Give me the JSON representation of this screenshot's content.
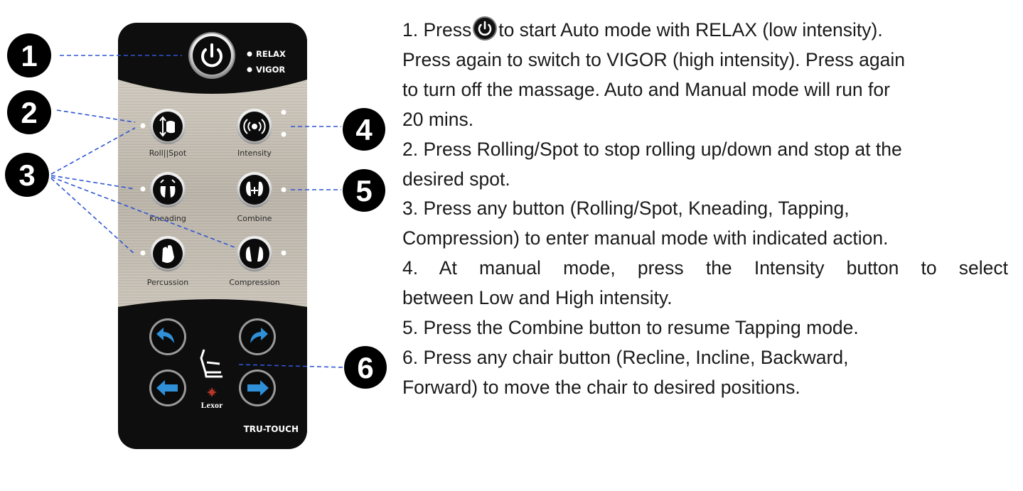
{
  "remote": {
    "mode_labels": [
      "RELAX",
      "VIGOR"
    ],
    "buttons": {
      "roll_spot": "Roll||Spot",
      "intensity": "Intensity",
      "kneading": "Kneading",
      "combine": "Combine",
      "percussion": "Percussion",
      "compression": "Compression"
    },
    "brand": "Lexor",
    "model": "TRU-TOUCH"
  },
  "callouts": [
    "1",
    "2",
    "3",
    "4",
    "5",
    "6"
  ],
  "instructions": {
    "s1_before": "1. Press",
    "s1_after": "to start Auto mode with RELAX (low intensity).",
    "s1_l2": "Press again to switch to VIGOR (high intensity). Press again",
    "s1_l3": "to turn off the massage. Auto and Manual mode will run for",
    "s1_l4": "20 mins.",
    "s2_l1": "2. Press Rolling/Spot to stop rolling up/down and stop at the",
    "s2_l2": "desired spot.",
    "s3_l1": "3.  Press  any  button  (Rolling/Spot, Kneading, Tapping,",
    "s3_l2": "Compression) to enter manual mode with indicated action.",
    "s4_l1": "4. At manual mode, press the Intensity button to select",
    "s4_l2": "between Low and High intensity.",
    "s5_l1": "5. Press the Combine button to resume Tapping mode.",
    "s6_l1": "6.  Press  any  chair  button  (Recline,  Incline,  Backward,",
    "s6_l2": "Forward) to move the chair to desired positions."
  },
  "colors": {
    "leader_line": "#2f55d4",
    "remote_body": "#0e0e0e",
    "button_face": "#0b0b0b",
    "arrow_blue": "#2f90d8"
  }
}
